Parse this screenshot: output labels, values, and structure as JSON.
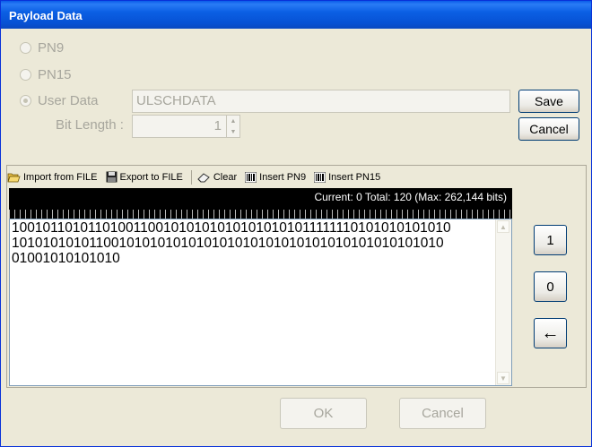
{
  "window": {
    "title": "Payload Data"
  },
  "options": {
    "pn9": "PN9",
    "pn15": "PN15",
    "user_data": "User Data",
    "user_data_value": "ULSCHDATA",
    "bit_length_label": "Bit Length :",
    "bit_length_value": "1"
  },
  "side_buttons": {
    "save": "Save",
    "cancel": "Cancel"
  },
  "toolbar": {
    "import": "Import from FILE",
    "export": "Export to FILE",
    "clear": "Clear",
    "insert_pn9": "Insert PN9",
    "insert_pn15": "Insert PN15"
  },
  "status": "Current: 0  Total: 120  (Max: 262,144 bits)",
  "editor": {
    "lines": [
      "1001011010110100110010101010101010101011111110101010101010",
      "10101010101100101010101010101010101010101010101010101010",
      "01001010101010"
    ]
  },
  "bit_buttons": {
    "one": "1",
    "zero": "0",
    "backspace": "←"
  },
  "footer": {
    "ok": "OK",
    "cancel": "Cancel"
  },
  "colors": {
    "titlebar": "#0a5ce8",
    "dialog_bg": "#ece9d8",
    "ruler_bg": "#000000"
  }
}
